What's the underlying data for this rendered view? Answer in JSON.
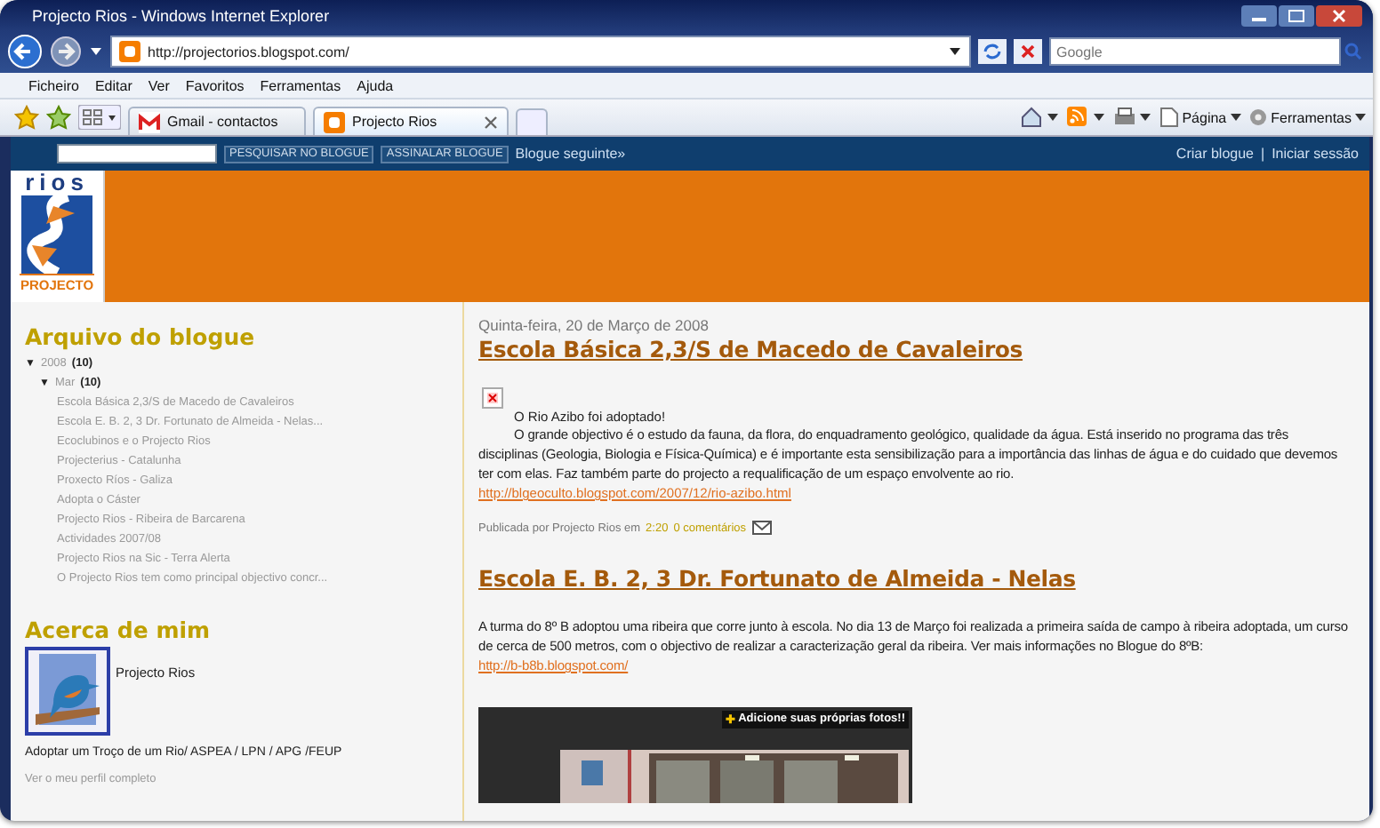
{
  "window": {
    "title": "Projecto Rios - Windows Internet Explorer"
  },
  "address_bar": {
    "url": "http://projectorios.blogspot.com/"
  },
  "search": {
    "placeholder": "Google"
  },
  "menu": [
    "Ficheiro",
    "Editar",
    "Ver",
    "Favoritos",
    "Ferramentas",
    "Ajuda"
  ],
  "tabs": [
    {
      "label": "Gmail - contactos",
      "selected": false,
      "kind": "gmail"
    },
    {
      "label": "Projecto Rios",
      "selected": true,
      "kind": "blogger"
    }
  ],
  "toolbar": [
    "Página",
    "Ferramentas"
  ],
  "navbar": {
    "buttons": [
      "PESQUISAR NO BLOGUE",
      "ASSINALAR BLOGUE"
    ],
    "next": "Blogue seguinte»",
    "links": [
      "Criar blogue",
      "Iniciar sessão"
    ],
    "separator": "|"
  },
  "logo": {
    "top": "rios",
    "bottom": "PROJECTO"
  },
  "sidebar": {
    "archive_title": "Arquivo do blogue",
    "tree": [
      {
        "toggle": "▼",
        "label": "2008",
        "count": "(10)",
        "expanded": true,
        "children": [
          {
            "toggle": "▼",
            "label": "Mar",
            "count": "(10)",
            "expanded": true,
            "children": [
              {
                "label": "Escola Básica 2,3/S de Macedo de Cavaleiros"
              },
              {
                "label": "Escola E. B. 2, 3 Dr. Fortunato de Almeida - Nelas..."
              },
              {
                "label": "Ecoclubinos e o Projecto Rios"
              },
              {
                "label": "Projecterius - Catalunha"
              },
              {
                "label": "Proxecto Ríos - Galiza"
              },
              {
                "label": "Adopta o Cáster"
              },
              {
                "label": "Projecto Rios - Ribeira de Barcarena"
              },
              {
                "label": "Actividades 2007/08"
              },
              {
                "label": "Projecto Rios na Sic - Terra Alerta"
              },
              {
                "label": "O Projecto Rios tem como principal objectivo concr..."
              }
            ]
          }
        ]
      }
    ],
    "about_title": "Acerca de mim",
    "about_name": "Projecto Rios",
    "about_text": "Adoptar um Troço de um Rio/ ASPEA / LPN / APG /FEUP",
    "profile_link": "Ver o meu perfil completo"
  },
  "main": {
    "date": "Quinta-feira, 20 de Março de 2008",
    "posts": [
      {
        "title": "Escola Básica 2,3/S de Macedo de Cavaleiros",
        "broken_image": true,
        "lead": "O Rio Azibo foi adoptado!",
        "body": "O grande objectivo é o estudo da fauna, da flora, do enquadramento geológico, qualidade da água. Está inserido no programa das três disciplinas (Geologia, Biologia e Física-Química) e é importante esta sensibilização para a importância das linhas de água e do cuidado que devemos ter com elas. Faz também parte do projecto a requalificação de um espaço envolvente ao rio.",
        "link": "http://blgeoculto.blogspot.com/2007/12/rio-azibo.html",
        "footer": {
          "by": "Publicada por Projecto Rios em",
          "time": "2:20",
          "comments": "0 comentários"
        }
      },
      {
        "title": "Escola E. B. 2, 3 Dr. Fortunato de Almeida - Nelas",
        "body": "A turma do 8º B adoptou uma ribeira que corre junto à escola. No dia 13 de Março foi realizada a primeira saída de campo à ribeira adoptada, um curso de cerca de 500 metros, com o objectivo de realizar a caracterização geral da ribeira. Ver mais informações no Blogue do 8ºB:",
        "link": "http://b-b8b.blogspot.com/"
      }
    ],
    "photo_widget": {
      "kind": "picture",
      "badge_icon": "✚",
      "badge": "Adicione suas próprias fotos!!"
    }
  }
}
